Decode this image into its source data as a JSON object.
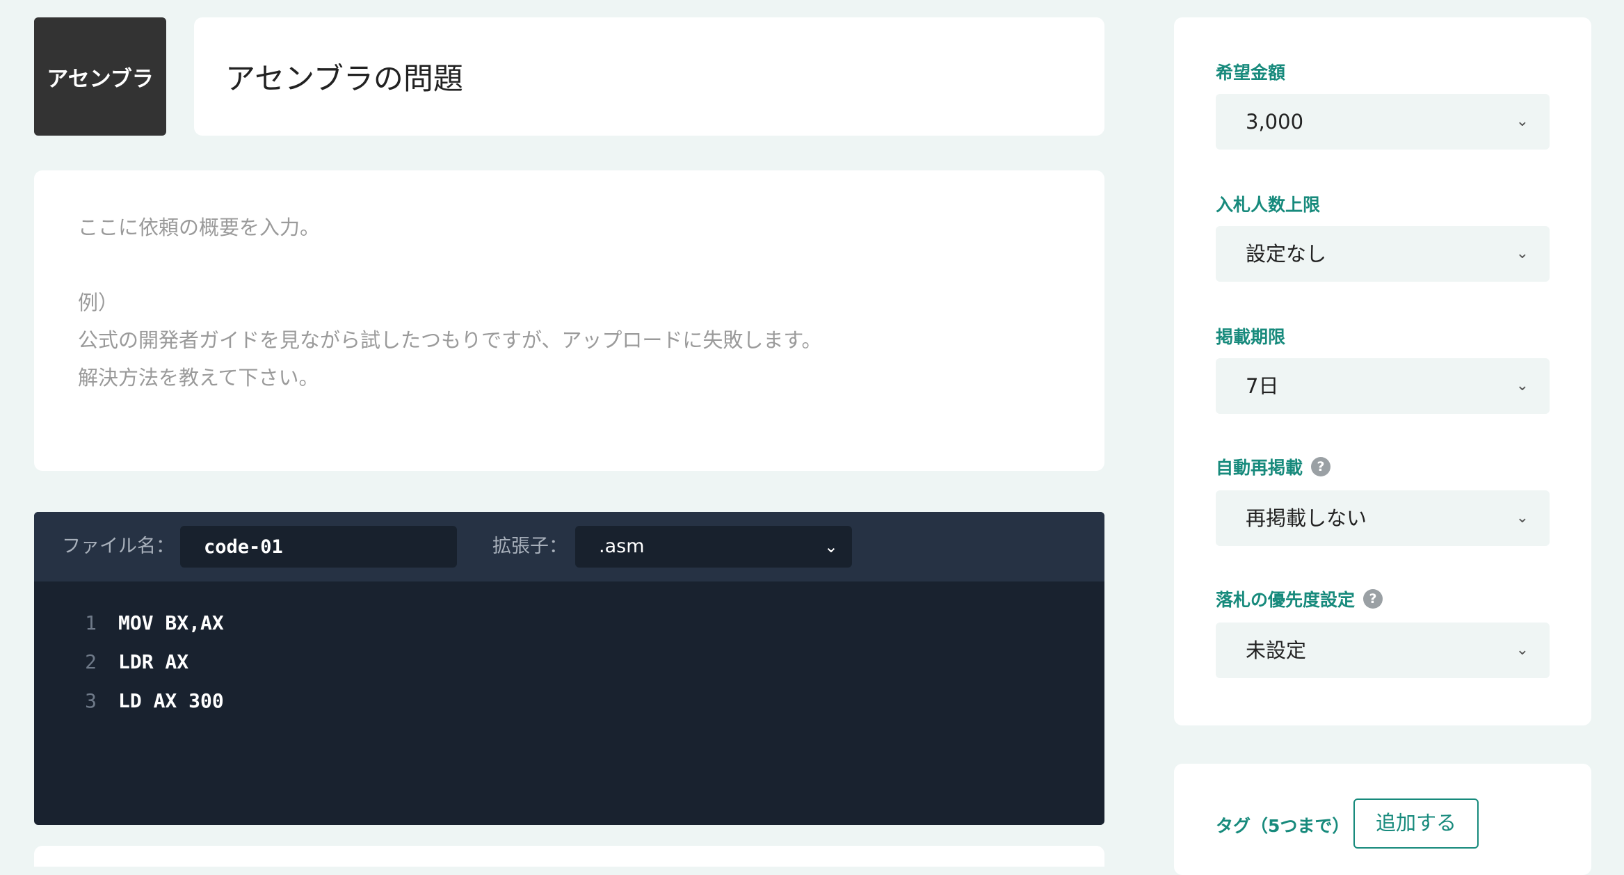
{
  "header": {
    "language_badge": "アセンブラ",
    "title": "アセンブラの問題"
  },
  "description": {
    "placeholder": "ここに依頼の概要を入力。\n\n例）\n公式の開発者ガイドを見ながら試したつもりですが、アップロードに失敗します。\n解決方法を教えて下さい。"
  },
  "editor": {
    "filename_label": "ファイル名：",
    "filename_value": "code-01",
    "extension_label": "拡張子：",
    "extension_value": ".asm",
    "lines": [
      {
        "no": "1",
        "code": "MOV BX,AX"
      },
      {
        "no": "2",
        "code": "LDR AX"
      },
      {
        "no": "3",
        "code": "LD AX 300"
      }
    ]
  },
  "settings": {
    "price_label": "希望金額",
    "price_value": "3,000",
    "bidder_limit_label": "入札人数上限",
    "bidder_limit_value": "設定なし",
    "period_label": "掲載期限",
    "period_value": "7日",
    "repost_label": "自動再掲載",
    "repost_value": "再掲載しない",
    "priority_label": "落札の優先度設定",
    "priority_value": "未設定",
    "help_glyph": "?",
    "chevron_glyph": "⌄"
  },
  "tags": {
    "label": "タグ（5つまで）",
    "add_button": "追加する"
  },
  "colors": {
    "accent": "#178a7c",
    "page_bg": "#eef5f4",
    "editor_bg": "#19222f",
    "editor_bar": "#263244",
    "badge_bg": "#333333"
  }
}
